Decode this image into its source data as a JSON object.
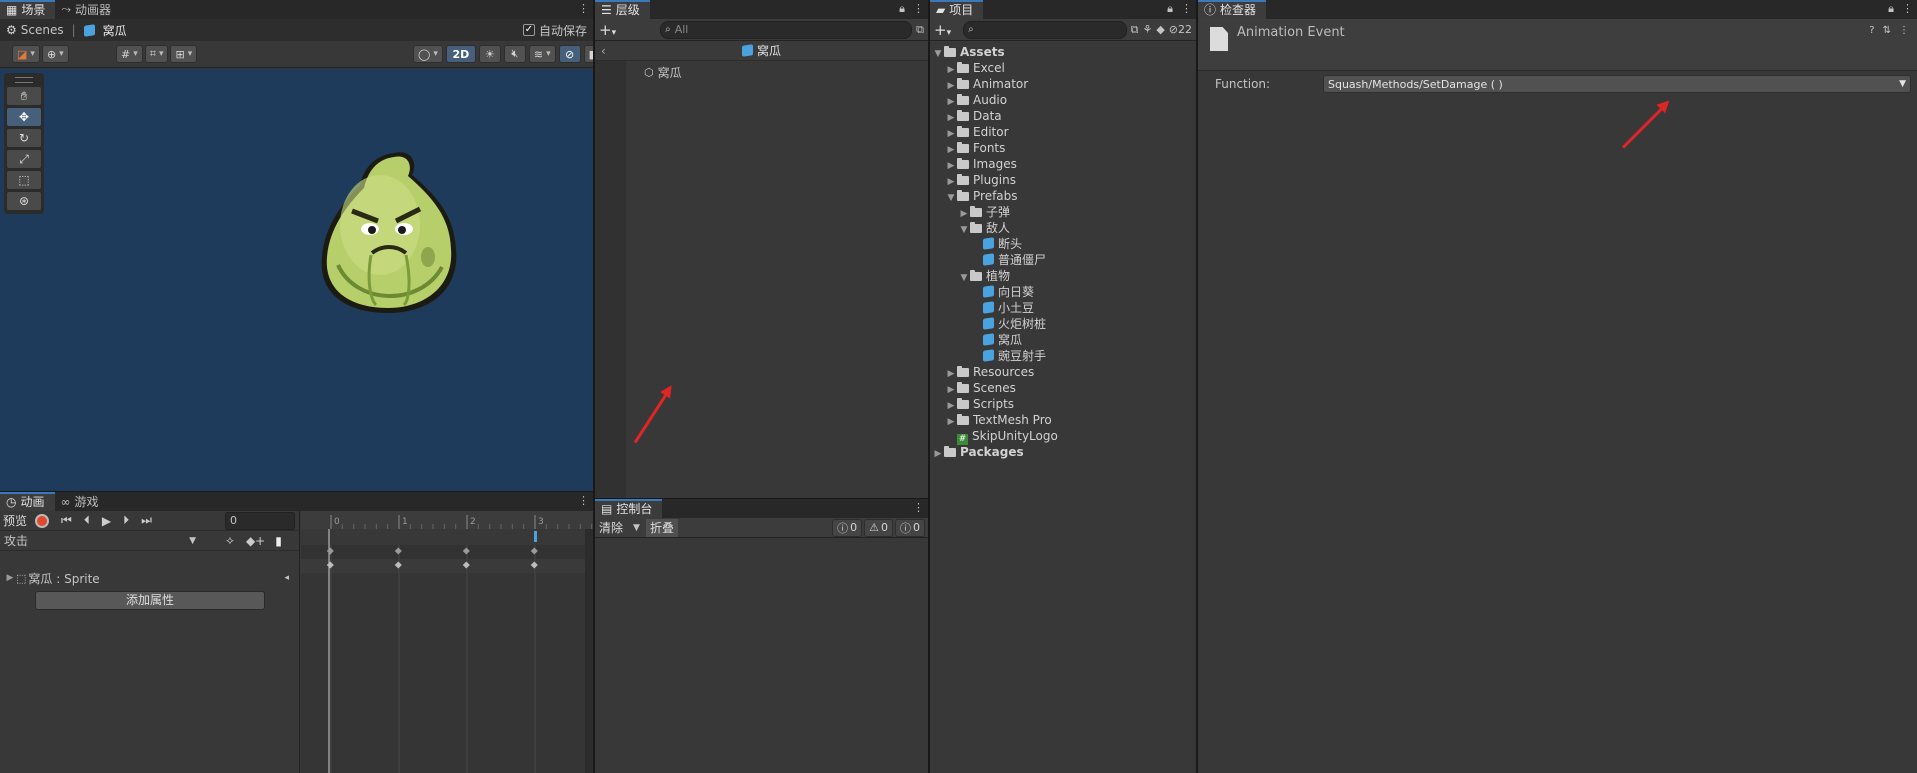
{
  "scene": {
    "tabs": [
      "场景",
      "动画器"
    ],
    "breadcrumb_root": "Scenes",
    "breadcrumb_item": "窝瓜",
    "autosave_label": "自动保存",
    "autosave_checked": true,
    "mode_2d_label": "2D",
    "tools": [
      "hand-tool",
      "move-tool",
      "rotate-tool",
      "scale-tool",
      "rect-tool",
      "transform-tool"
    ]
  },
  "animation": {
    "tabs": [
      "动画",
      "游戏"
    ],
    "preview_label": "预览",
    "frame_value": "0",
    "clip_name": "攻击",
    "property_label": "窝瓜 : Sprite",
    "add_property_label": "添加属性",
    "ruler_labels": [
      "0",
      "1",
      "2",
      "3",
      "4"
    ],
    "keyframes_at": [
      0,
      1,
      2,
      3
    ],
    "event_at": 3
  },
  "hierarchy": {
    "tab": "层级",
    "search_placeholder": "All",
    "scene_title": "窝瓜",
    "items": [
      "窝瓜"
    ]
  },
  "console": {
    "tab": "控制台",
    "clear_label": "清除",
    "collapse_label": "折叠",
    "info_count": "0",
    "warn_count": "0",
    "error_count": "0"
  },
  "project": {
    "tab": "项目",
    "hidden_count": "22",
    "tree": [
      {
        "label": "Assets",
        "type": "folder",
        "depth": 0,
        "fold": "open",
        "bold": true
      },
      {
        "label": "Excel",
        "type": "folder",
        "depth": 1,
        "fold": "closed"
      },
      {
        "label": "Animator",
        "type": "folder",
        "depth": 1,
        "fold": "closed"
      },
      {
        "label": "Audio",
        "type": "folder",
        "depth": 1,
        "fold": "closed"
      },
      {
        "label": "Data",
        "type": "folder",
        "depth": 1,
        "fold": "closed"
      },
      {
        "label": "Editor",
        "type": "folder",
        "depth": 1,
        "fold": "closed"
      },
      {
        "label": "Fonts",
        "type": "folder",
        "depth": 1,
        "fold": "closed"
      },
      {
        "label": "Images",
        "type": "folder",
        "depth": 1,
        "fold": "closed"
      },
      {
        "label": "Plugins",
        "type": "folder",
        "depth": 1,
        "fold": "closed"
      },
      {
        "label": "Prefabs",
        "type": "folder",
        "depth": 1,
        "fold": "open"
      },
      {
        "label": "子弹",
        "type": "folder",
        "depth": 2,
        "fold": "closed"
      },
      {
        "label": "敌人",
        "type": "folder",
        "depth": 2,
        "fold": "open"
      },
      {
        "label": "断头",
        "type": "prefab",
        "depth": 3,
        "fold": ""
      },
      {
        "label": "普通僵尸",
        "type": "prefab",
        "depth": 3,
        "fold": ""
      },
      {
        "label": "植物",
        "type": "folder",
        "depth": 2,
        "fold": "open"
      },
      {
        "label": "向日葵",
        "type": "prefab",
        "depth": 3,
        "fold": ""
      },
      {
        "label": "小土豆",
        "type": "prefab",
        "depth": 3,
        "fold": ""
      },
      {
        "label": "火炬树桩",
        "type": "prefab",
        "depth": 3,
        "fold": ""
      },
      {
        "label": "窝瓜",
        "type": "prefab",
        "depth": 3,
        "fold": ""
      },
      {
        "label": "豌豆射手",
        "type": "prefab",
        "depth": 3,
        "fold": ""
      },
      {
        "label": "Resources",
        "type": "folder",
        "depth": 1,
        "fold": "closed"
      },
      {
        "label": "Scenes",
        "type": "folder",
        "depth": 1,
        "fold": "closed"
      },
      {
        "label": "Scripts",
        "type": "folder",
        "depth": 1,
        "fold": "closed"
      },
      {
        "label": "TextMesh Pro",
        "type": "folder",
        "depth": 1,
        "fold": "closed"
      },
      {
        "label": "SkipUnityLogo",
        "type": "script",
        "depth": 1,
        "fold": ""
      },
      {
        "label": "Packages",
        "type": "folder",
        "depth": 0,
        "fold": "closed",
        "bold": true
      }
    ]
  },
  "inspector": {
    "tab": "检查器",
    "title": "Animation Event",
    "function_label": "Function:",
    "function_value": "Squash/Methods/SetDamage ( )"
  },
  "colors": {
    "accent": "#3a79bb",
    "scene_bg": "#1f3b5b",
    "annotation_arrow": "#e02525",
    "prefab_icon": "#4aa3df"
  }
}
